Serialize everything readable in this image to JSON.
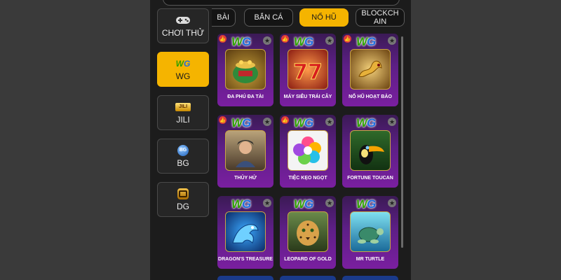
{
  "tabs": [
    {
      "label": "BÀI"
    },
    {
      "label": "BẮN CÁ"
    },
    {
      "label": "NỔ HŨ",
      "active": true
    },
    {
      "label": "BLOCKCH AIN"
    }
  ],
  "providers": [
    {
      "label": "CHƠI THỬ",
      "icon": "gamepad-icon"
    },
    {
      "label": "WG",
      "icon": "wg-logo-icon",
      "active": true
    },
    {
      "label": "JILI",
      "icon": "jili-logo-icon"
    },
    {
      "label": "BG",
      "icon": "bg-logo-icon"
    },
    {
      "label": "DG",
      "icon": "dg-logo-icon"
    }
  ],
  "provider_logo_text": {
    "wg": "WG",
    "jili": "JILI",
    "bg": "BG"
  },
  "games": [
    {
      "title": "ĐA PHÚ ĐA TÀI",
      "liked": true
    },
    {
      "title": "MÁY SIÊU TRÁI CÂY",
      "liked": true
    },
    {
      "title": "NỔ HŨ HOẠT BẢO",
      "liked": true
    },
    {
      "title": "THỦY HỬ",
      "liked": true
    },
    {
      "title": "TIỆC KẸO NGỌT",
      "liked": true
    },
    {
      "title": "FORTUNE TOUCAN",
      "liked": false
    },
    {
      "title": "DRAGON'S TREASURE",
      "liked": false
    },
    {
      "title": "LEOPARD OF GOLD",
      "liked": false
    },
    {
      "title": "MR TURTLE",
      "liked": false
    }
  ],
  "card_logo": {
    "w": "W",
    "g": "G"
  },
  "colors": {
    "accent": "#f5b400",
    "card": "#5d1f86"
  }
}
